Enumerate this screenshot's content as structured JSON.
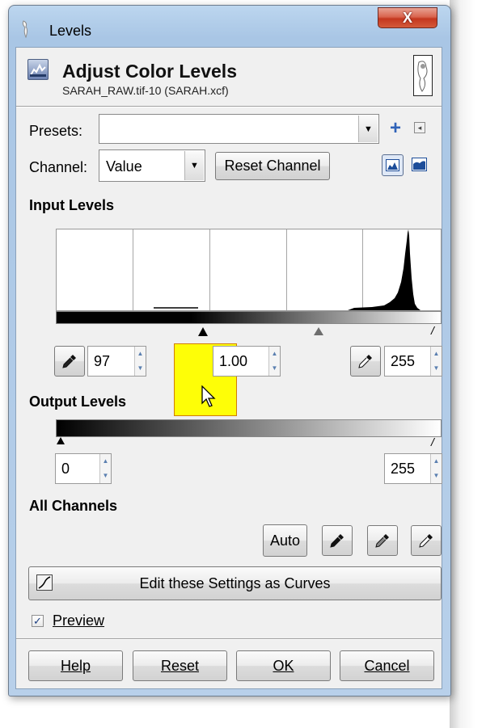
{
  "window": {
    "title": "Levels",
    "close_glyph": "X"
  },
  "header": {
    "title": "Adjust Color Levels",
    "subtitle": "SARAH_RAW.tif-10 (SARAH.xcf)"
  },
  "presets": {
    "label": "Presets:",
    "value": "",
    "add_glyph": "+",
    "menu_glyph": "◂"
  },
  "channel": {
    "label": "Channel:",
    "value": "Value",
    "reset_button": "Reset Channel"
  },
  "input_levels": {
    "heading": "Input Levels",
    "low": "97",
    "gamma": "1.00",
    "high": "255"
  },
  "output_levels": {
    "heading": "Output Levels",
    "low": "0",
    "high": "255"
  },
  "all_channels": {
    "heading": "All Channels",
    "auto_button": "Auto"
  },
  "curves_button": "Edit these Settings as Curves",
  "preview": {
    "label": "Preview",
    "checked": true
  },
  "footer": {
    "help": "Help",
    "reset": "Reset",
    "ok": "OK",
    "cancel": "Cancel"
  },
  "colors": {
    "titlebar": "#a9c6e5",
    "close": "#c4371f",
    "highlight": "#ffff00",
    "spin_arrow": "#5a7fb0"
  },
  "icons": [
    "app-icon",
    "levels-icon",
    "eyedropper-icon",
    "linear-histogram-icon",
    "log-histogram-icon",
    "curves-icon",
    "mouse-cursor-icon"
  ]
}
